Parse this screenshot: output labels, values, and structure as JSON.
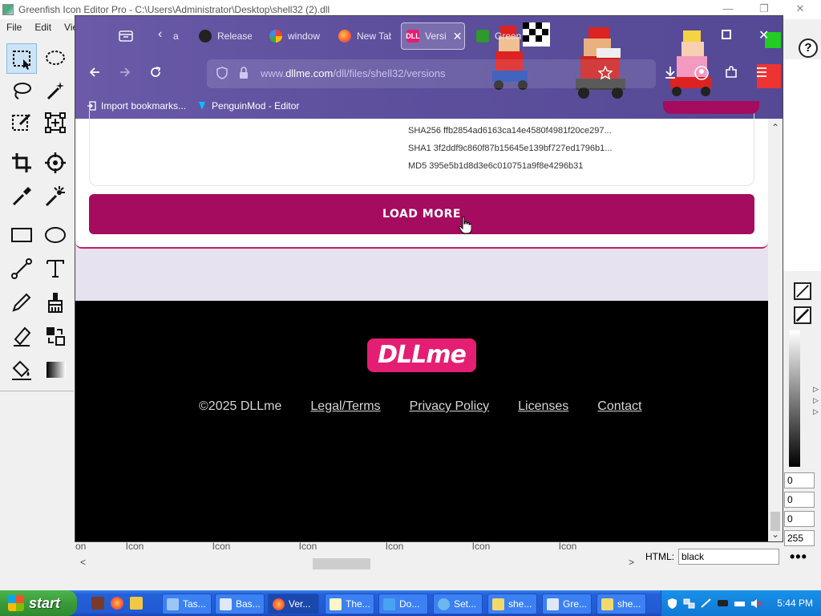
{
  "greenfish": {
    "title": "Greenfish Icon Editor Pro - C:\\Users\\Administrator\\Desktop\\shell32 (2).dll",
    "menu": [
      "File",
      "Edit",
      "Vie"
    ],
    "win_minimize": "—",
    "win_restore": "❐",
    "win_close": "✕",
    "help": "?",
    "numbers": [
      "0",
      "0",
      "0",
      "255"
    ],
    "html_label": "HTML:",
    "html_value": "black",
    "more": "•••",
    "icon_labels": [
      "on",
      "Icon",
      "Icon",
      "Icon",
      "Icon",
      "Icon",
      "Icon"
    ],
    "scroll_left": "<",
    "scroll_right": ">",
    "grad_arrows": "▷\n▷\n▷"
  },
  "firefox": {
    "tabs": [
      {
        "label": "a",
        "icon": "tab-overflow"
      },
      {
        "label": "Release",
        "icon": "github-icon"
      },
      {
        "label": "window",
        "icon": "google-icon"
      },
      {
        "label": "New Tab",
        "icon": "firefox-icon"
      },
      {
        "label": "Versi",
        "icon": "dllme-icon"
      },
      {
        "label": "Green",
        "icon": "greenfish-icon"
      }
    ],
    "active_tab_icon_text": "DLL",
    "url_prefix": "www.",
    "url_domain": "dllme.com",
    "url_path": "/dll/files/shell32/versions",
    "bookmarks": [
      "Import bookmarks...",
      "PenguinMod - Editor"
    ],
    "accent": "#5d4f9c"
  },
  "page": {
    "hashes": [
      "SHA256 ffb2854ad6163ca14e4580f4981f20ce297...",
      "SHA1 3f2ddf9c860f87b15645e139bf727ed1796b1...",
      "MD5 395e5b1d8d3e6c010751a9f8e4296b31"
    ],
    "load_more": "LOAD MORE",
    "logo": "DLLme",
    "copyright": "©2025 DLLme",
    "links": [
      "Legal/Terms",
      "Privacy Policy",
      "Licenses",
      "Contact"
    ],
    "brand_color": "#a50b5e",
    "logo_color": "#e41e73"
  },
  "taskbar": {
    "start": "start",
    "tasks": [
      {
        "label": "Tas...",
        "icon": "taskmgr-icon"
      },
      {
        "label": "Bas...",
        "icon": "window-icon"
      },
      {
        "label": "Ver...",
        "icon": "firefox-icon"
      },
      {
        "label": "The...",
        "icon": "notepad-icon"
      },
      {
        "label": "Do...",
        "icon": "download-icon"
      },
      {
        "label": "Set...",
        "icon": "settings-icon"
      },
      {
        "label": "she...",
        "icon": "folder-icon"
      },
      {
        "label": "Gre...",
        "icon": "greenfish-icon"
      },
      {
        "label": "she...",
        "icon": "folder-icon"
      }
    ],
    "clock": "5:44 PM"
  }
}
